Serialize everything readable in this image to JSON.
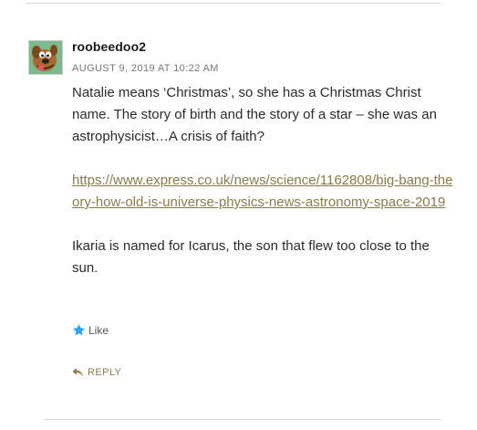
{
  "comment": {
    "author": "roobeedoo2",
    "date": "AUGUST 9, 2019 AT 10:22 AM",
    "paragraph1": "Natalie means ‘Christmas’, so she has a Christmas Christ name. The story of birth and the story of a star – she was an astrophysicist…A crisis of faith?",
    "link": "https://www.express.co.uk/news/science/1162808/big-bang-theory-how-old-is-universe-physics-news-astronomy-space-2019",
    "paragraph3": "Ikaria is named for Icarus, the son that flew too close to the sun."
  },
  "actions": {
    "like_label": "Like",
    "reply_label": "REPLY"
  },
  "icons": {
    "avatar": "avatar-image",
    "like": "star-icon",
    "reply": "reply-arrow-icon"
  },
  "colors": {
    "link": "#8a7a4c",
    "star": "#2ea3f2",
    "meta": "#767676"
  }
}
